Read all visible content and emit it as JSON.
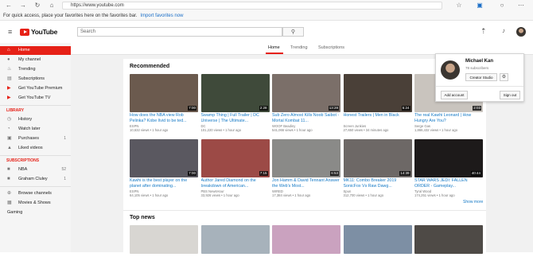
{
  "browser": {
    "url": "https://www.youtube.com",
    "favorites_text": "For quick access, place your favorites here on the favorites bar.",
    "favorites_link": "Import favorites now"
  },
  "header": {
    "logo_text": "YouTube",
    "search_placeholder": "Search"
  },
  "sidebar": {
    "items": [
      {
        "label": "Home",
        "icon": "home-icon",
        "glyph": "⌂"
      },
      {
        "label": "My channel",
        "icon": "person-icon",
        "glyph": "●"
      },
      {
        "label": "Trending",
        "icon": "flame-icon",
        "glyph": "♨"
      },
      {
        "label": "Subscriptions",
        "icon": "subscriptions-icon",
        "glyph": "▤"
      },
      {
        "label": "Get YouTube Premium",
        "icon": "youtube-red-icon",
        "glyph": "▶"
      },
      {
        "label": "Get YouTube TV",
        "icon": "youtube-tv-icon",
        "glyph": "▶"
      }
    ],
    "library_heading": "LIBRARY",
    "library": [
      {
        "label": "History",
        "icon": "history-icon",
        "glyph": "◷"
      },
      {
        "label": "Watch later",
        "icon": "clock-icon",
        "glyph": "◔"
      },
      {
        "label": "Purchases",
        "icon": "purchases-icon",
        "glyph": "▣",
        "count": "1"
      },
      {
        "label": "Liked videos",
        "icon": "thumb-up-icon",
        "glyph": "▲"
      }
    ],
    "subscriptions_heading": "SUBSCRIPTIONS",
    "subscriptions": [
      {
        "label": "NBA",
        "icon": "nba-avatar",
        "glyph": "■",
        "count": "52"
      },
      {
        "label": "Graham Cluley",
        "icon": "graham-avatar",
        "glyph": "■",
        "count": "1"
      }
    ],
    "more": [
      {
        "label": "Browse channels",
        "icon": "add-circle-icon",
        "glyph": "⊕"
      },
      {
        "label": "Movies & Shows",
        "icon": "film-icon",
        "glyph": "▦"
      },
      {
        "label": "Gaming",
        "icon": "",
        "glyph": ""
      }
    ]
  },
  "tabs": [
    {
      "label": "Home"
    },
    {
      "label": "Trending"
    },
    {
      "label": "Subscriptions"
    }
  ],
  "recommended": {
    "title": "Recommended",
    "row1": [
      {
        "title": "How does the NBA view Rob Pelinka? Kobe lívid to be ted...",
        "channel": "ESPN",
        "meta": "10,632 views • 1 hour ago",
        "duration": "7:00",
        "color": "#6b5a4e"
      },
      {
        "title": "Swamp Thing | Full Trailer | DC Universe | The Ultimate...",
        "channel": "DC",
        "meta": "101,220 views • 1 hour ago",
        "duration": "2:28",
        "color": "#3f4a3a"
      },
      {
        "title": "Sub Zero Almost Kills Noob Saibot - Mortal Kombat 11...",
        "channel": "WOOF Beadiny",
        "meta": "541,066 views • 1 hour ago",
        "duration": "13:28",
        "color": "#7b6f69"
      },
      {
        "title": "Honest Trailers | Men in Black",
        "channel": "Screen Junkies",
        "meta": "27,650 views • 34 minutes ago",
        "duration": "5:24",
        "color": "#4a4038"
      },
      {
        "title": "The real Kawhi Leonard | How Hungry Are You?",
        "channel": "Serge Gas",
        "meta": "1,866,432 views • 1 hour ago",
        "duration": "2:03",
        "color": "#c9c4be"
      }
    ],
    "row2": [
      {
        "title": "Kawhi is the best player on the planet after dominating...",
        "channel": "ESPN",
        "meta": "64,105 views • 1 hour ago",
        "duration": "7:00",
        "color": "#5a5860"
      },
      {
        "title": "Author Jared Diamond on the breakdown of American...",
        "channel": "PBS NewsHour",
        "meta": "33,926 views • 1 hour ago",
        "duration": "7:15",
        "color": "#9c4a46"
      },
      {
        "title": "Jon Hamm & David Tennant Answer the Web's Most...",
        "channel": "WIRED",
        "meta": "17,384 views • 1 hour ago",
        "duration": "6:53",
        "color": "#8a8a88"
      },
      {
        "title": "MK11: Combo Breaker 2019 SonicFox Vs Raw Dawg...",
        "channel": "Spun",
        "meta": "312,700 views • 1 hour ago",
        "duration": "14:39",
        "color": "#6d6866"
      },
      {
        "title": "STAR WARS JEDI: FALLEN ORDER - Gameplay...",
        "channel": "Tyral Wood",
        "meta": "174,251 views • 1 hour ago",
        "duration": "40:44",
        "color": "#1d1a1a"
      }
    ],
    "show_more": "Show more"
  },
  "top_news": {
    "title": "Top news",
    "items": [
      {
        "color": "#d8d6d2"
      },
      {
        "color": "#a7b2bb"
      },
      {
        "color": "#caa2bf"
      },
      {
        "color": "#7d8fa4"
      },
      {
        "color": "#4e4a46"
      }
    ]
  },
  "account": {
    "name": "Michael Kan",
    "subscribers": "78 subscribers",
    "creator_studio": "Creator Studio",
    "add_account": "Add account",
    "sign_out": "Sign out"
  },
  "colors": {
    "accent": "#e62117",
    "link": "#167ac6"
  }
}
